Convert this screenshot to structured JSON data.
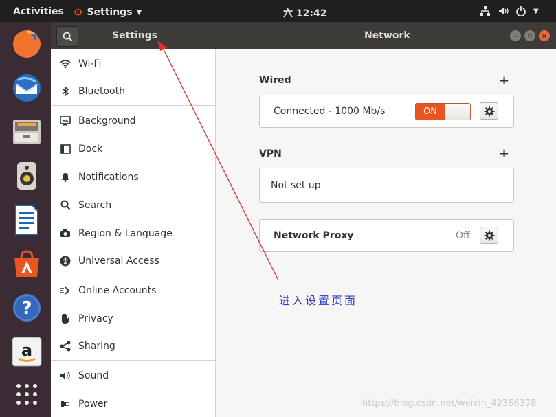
{
  "topbar": {
    "activities": "Activities",
    "app_menu": "Settings",
    "clock": "六 12:42"
  },
  "dock": {
    "items": [
      "firefox-icon",
      "thunderbird-icon",
      "files-icon",
      "rhythmbox-icon",
      "writer-icon",
      "software-icon",
      "help-icon",
      "amazon-icon",
      "app-grid-icon"
    ]
  },
  "header": {
    "left_title": "Settings",
    "right_title": "Network"
  },
  "sidebar": {
    "items": [
      {
        "label": "Wi-Fi",
        "icon": "wifi-icon"
      },
      {
        "label": "Bluetooth",
        "icon": "bluetooth-icon"
      },
      {
        "label": "Background",
        "icon": "background-icon"
      },
      {
        "label": "Dock",
        "icon": "dock-icon"
      },
      {
        "label": "Notifications",
        "icon": "bell-icon"
      },
      {
        "label": "Search",
        "icon": "search-icon"
      },
      {
        "label": "Region & Language",
        "icon": "camera-icon"
      },
      {
        "label": "Universal Access",
        "icon": "accessibility-icon"
      },
      {
        "label": "Online Accounts",
        "icon": "online-accounts-icon"
      },
      {
        "label": "Privacy",
        "icon": "hand-icon"
      },
      {
        "label": "Sharing",
        "icon": "share-icon"
      },
      {
        "label": "Sound",
        "icon": "speaker-icon"
      },
      {
        "label": "Power",
        "icon": "power-plug-icon"
      }
    ]
  },
  "main": {
    "wired": {
      "title": "Wired",
      "status": "Connected - 1000 Mb/s",
      "switch_label": "ON"
    },
    "vpn": {
      "title": "VPN",
      "status": "Not set up"
    },
    "proxy": {
      "label": "Network Proxy",
      "value": "Off"
    }
  },
  "annotation": "进入设置页面",
  "watermark": "https://blog.csdn.net/weixin_42366378",
  "colors": {
    "accent": "#e95420",
    "annotation": "#d93030"
  }
}
